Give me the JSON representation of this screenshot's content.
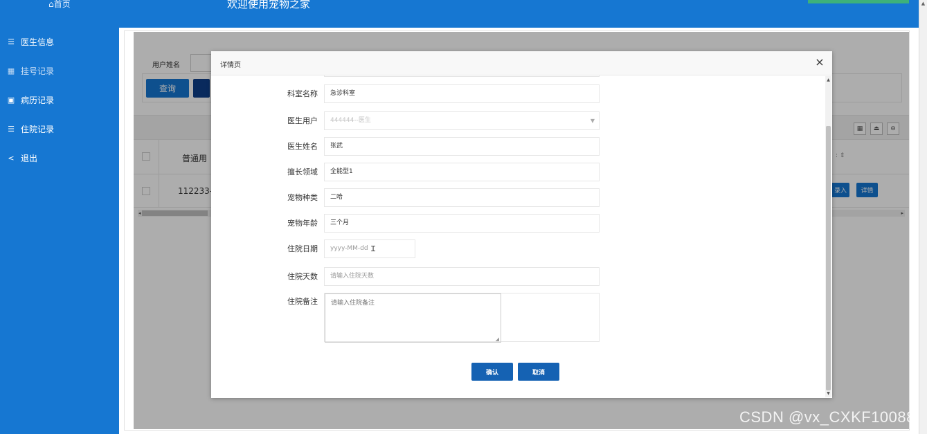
{
  "sidebar": {
    "home": "首页",
    "items": [
      {
        "icon": "list-icon",
        "glyph": "☰",
        "label": "医生信息"
      },
      {
        "icon": "grid-icon",
        "glyph": "▦",
        "label": "挂号记录"
      },
      {
        "icon": "record-icon",
        "glyph": "▣",
        "label": "病历记录"
      },
      {
        "icon": "list-icon",
        "glyph": "☰",
        "label": "住院记录"
      },
      {
        "icon": "share-icon",
        "glyph": "<",
        "label": "退出"
      }
    ]
  },
  "header": {
    "title": "欢迎使用宠物之家"
  },
  "background": {
    "search_label": "用户姓名",
    "search_button": "查询",
    "table_header": "普通用",
    "table_cell": "112233-",
    "row_button_1": "录入",
    "row_button_2": "详情"
  },
  "modal": {
    "title": "详情页",
    "close": "×",
    "fields": [
      {
        "label": "科室名称",
        "value": "急诊科室",
        "type": "text"
      },
      {
        "label": "医生用户",
        "value": "444444--医生",
        "type": "select-disabled"
      },
      {
        "label": "医生姓名",
        "value": "张武",
        "type": "text"
      },
      {
        "label": "擅长领域",
        "value": "全能型1",
        "type": "text"
      },
      {
        "label": "宠物种类",
        "value": "二哈",
        "type": "text"
      },
      {
        "label": "宠物年龄",
        "value": "三个月",
        "type": "text"
      },
      {
        "label": "住院日期",
        "placeholder": "yyyy-MM-dd",
        "type": "date"
      },
      {
        "label": "住院天数",
        "placeholder": "请输入住院天数",
        "type": "text"
      },
      {
        "label": "住院备注",
        "placeholder": "请输入住院备注",
        "type": "textarea"
      }
    ],
    "confirm": "确认",
    "cancel": "取消"
  },
  "watermark": "CSDN @vx_CXKF10088",
  "colors": {
    "sidebar": "#1677d2",
    "header": "#1677d2",
    "primary_button": "#1562b3",
    "overlay": "rgba(0,0,0,0.32)"
  }
}
